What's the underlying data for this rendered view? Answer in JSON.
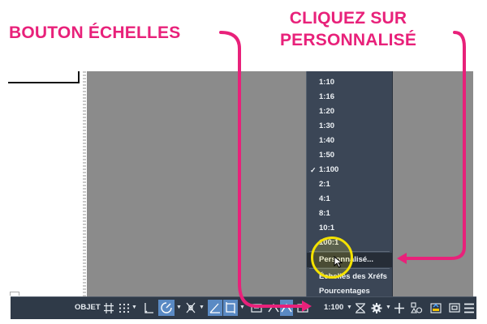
{
  "annotations": {
    "left": "BOUTON ÉCHELLES",
    "right_line1": "CLIQUEZ SUR",
    "right_line2": "PERSONNALISÉ"
  },
  "scale_menu": {
    "items": [
      {
        "label": "1:10"
      },
      {
        "label": "1:16"
      },
      {
        "label": "1:20"
      },
      {
        "label": "1:30"
      },
      {
        "label": "1:40"
      },
      {
        "label": "1:50"
      },
      {
        "label": "1:100",
        "checked": true
      },
      {
        "label": "2:1"
      },
      {
        "label": "4:1"
      },
      {
        "label": "8:1"
      },
      {
        "label": "10:1"
      },
      {
        "label": "100:1"
      }
    ],
    "custom": "Personnalisé...",
    "xref_scales": "Échelles des Xréfs",
    "percentages": "Pourcentages",
    "check_mark": "✓"
  },
  "statusbar": {
    "model_label": "OBJET",
    "scale_value": "1:100"
  },
  "colors": {
    "annotation": "#e8217a",
    "menu_bg": "#3b4656",
    "statusbar_bg": "#2f3a48",
    "highlight": "#f4e200",
    "active_button": "#5a8ac4"
  },
  "icons": [
    "grid-icon",
    "snap-dots-icon",
    "ortho-icon",
    "polar-tracking-icon",
    "osnap-icon",
    "isodraft-icon",
    "otrack-icon",
    "annotation-visibility-icon",
    "auto-scale-icon",
    "annotation-scale-icon",
    "workspace-gear-icon",
    "plus-icon",
    "isolate-objects-icon",
    "hardware-acceleration-icon",
    "clean-screen-icon",
    "customization-menu-icon"
  ]
}
